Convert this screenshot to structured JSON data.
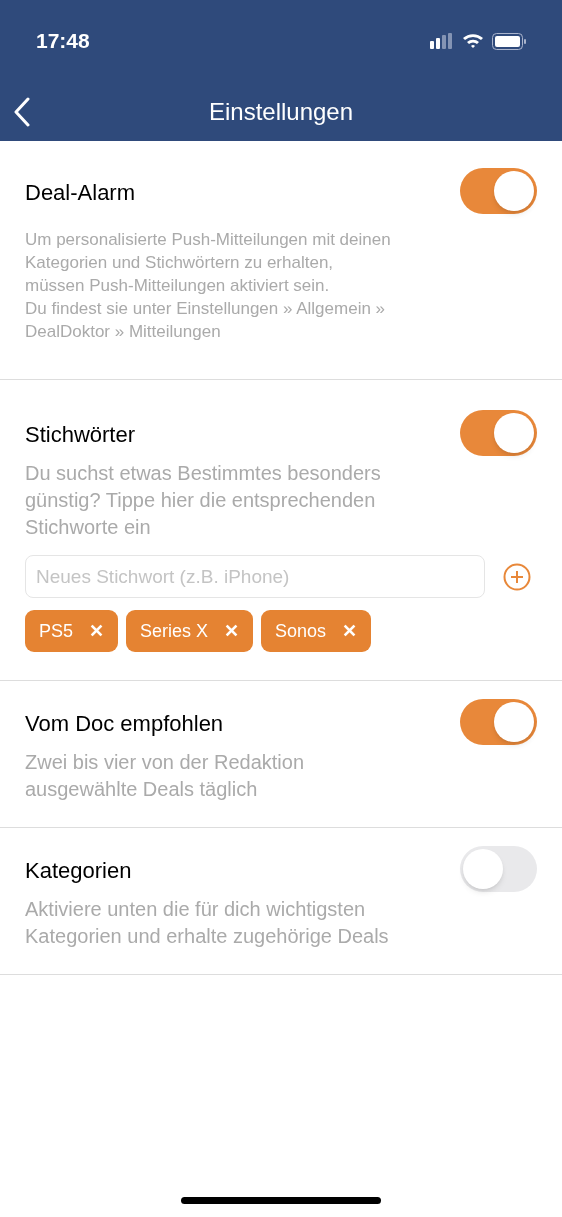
{
  "status_bar": {
    "time": "17:48"
  },
  "nav": {
    "title": "Einstellungen"
  },
  "sections": [
    {
      "kind": "notice",
      "title": "Deal-Alarm",
      "on": true,
      "description": "Um personalisierte Push-Mitteilungen mit deinen\nKategorien und Stichwörtern zu erhalten,\nmüssen Push-Mitteilungen aktiviert sein.\nDu findest sie unter Einstellungen » Allgemein »\nDealDoktor » Mitteilungen"
    },
    {
      "kind": "keywords",
      "title": "Stichwörter",
      "on": true,
      "description": "Du suchst etwas Bestimmtes besonders\ngünstig? Tippe hier die entsprechenden\nStichworte ein",
      "placeholder": "Neues Stichwort (z.B. iPhone)",
      "tags": [
        {
          "label": "PS5",
          "remove": "✕"
        },
        {
          "label": "Series X",
          "remove": "✕"
        },
        {
          "label": "Sonos",
          "remove": "✕"
        }
      ]
    },
    {
      "kind": "toggle",
      "title": "Vom Doc empfohlen",
      "on": true,
      "description": "Zwei bis vier von der Redaktion\nausgewählte Deals täglich"
    },
    {
      "kind": "toggle",
      "title": "Kategorien",
      "on": false,
      "description": "Aktiviere unten die für dich wichtigsten\nKategorien und erhalte zugehörige Deals"
    }
  ]
}
